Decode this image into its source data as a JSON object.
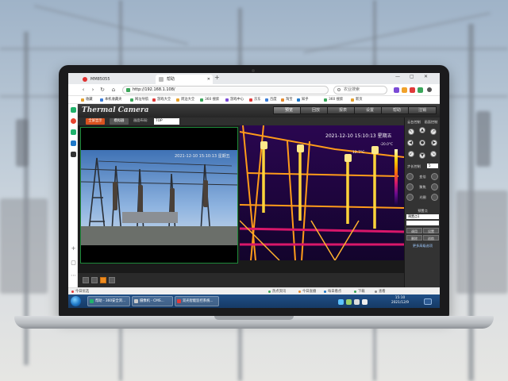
{
  "browser": {
    "tabs": [
      {
        "label": "MM85055",
        "icon_color": "#e03030"
      },
      {
        "label": "帮助",
        "icon_color": "#888888"
      }
    ],
    "url": "http://192.168.1.108/",
    "search_placeholder": "农业搜索",
    "bookmarks": [
      "收藏",
      "本机收藏夹",
      "网址导航",
      "游戏大全",
      "周边大全",
      "360 搜索",
      "游戏中心",
      "京东",
      "百度",
      "淘宝",
      "知乎",
      "360 搜索",
      "新页"
    ]
  },
  "app": {
    "title": "Thermal Camera",
    "nav": [
      "预览",
      "回放",
      "报表",
      "设置",
      "帮助",
      "注销"
    ],
    "video_controls": {
      "btn_primary": "全屏显示",
      "btn_secondary": "模拟器",
      "stream_label": "画面布局:",
      "stream_value": "TOP"
    },
    "visible_osd": "2021-12-10 15:10:13 星期五",
    "thermal_osd": "2021-12-10 15:10:13 星期五",
    "scale_max": "-20.0°C",
    "scale_point": "12.7°C",
    "ptz": {
      "header_top": "云台控制",
      "header_top_right": "画面控制",
      "arrows": [
        "↖",
        "▲",
        "↗",
        "◀",
        "●",
        "▶",
        "↙",
        "▼",
        "↘"
      ],
      "speed_header": "步长控制",
      "speed_value": "5",
      "rows": [
        "变倍",
        "聚焦",
        "光圈"
      ],
      "preset_header": "预置点",
      "preset_value": "预置点1",
      "preset_value2": "",
      "btns": [
        "调用",
        "设置",
        "删除",
        "巡航"
      ],
      "link": "更多高级选项"
    }
  },
  "statusline": {
    "left": "今日优选",
    "items": [
      "热点资讯",
      "今日直播",
      "每日看点",
      "下载",
      "查看"
    ]
  },
  "taskbar": {
    "tasks": [
      "帮助 - 360安全浏...",
      "摄像机 - CMS...",
      "双光智能监控系统..."
    ],
    "time": "15:10",
    "date": "2021/12/9"
  }
}
